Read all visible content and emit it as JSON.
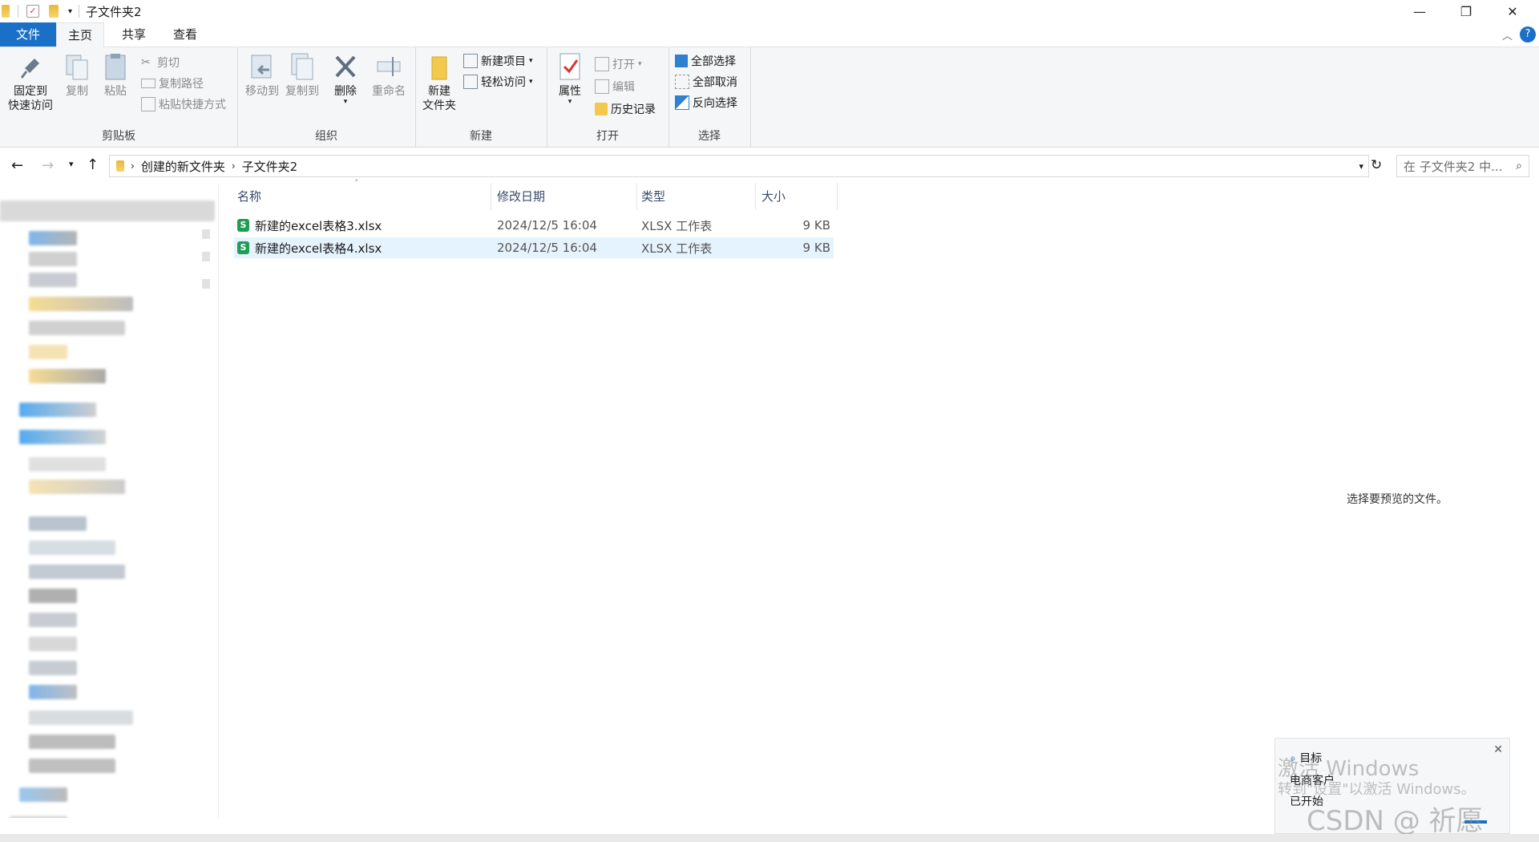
{
  "window": {
    "title": "子文件夹2",
    "controls": {
      "minimize": "—",
      "maximize": "❐",
      "close": "✕"
    }
  },
  "tabs": [
    {
      "label": "文件"
    },
    {
      "label": "主页"
    },
    {
      "label": "共享"
    },
    {
      "label": "查看"
    }
  ],
  "ribbon": {
    "clipboard": {
      "pin_label_1": "固定到",
      "pin_label_2": "快速访问",
      "copy": "复制",
      "paste": "粘贴",
      "cut": "剪切",
      "copy_path": "复制路径",
      "paste_shortcut": "粘贴快捷方式",
      "group": "剪贴板"
    },
    "organize": {
      "move_to": "移动到",
      "copy_to": "复制到",
      "delete": "删除",
      "rename": "重命名",
      "group": "组织"
    },
    "new": {
      "new_folder_1": "新建",
      "new_folder_2": "文件夹",
      "new_item": "新建项目",
      "easy_access": "轻松访问",
      "group": "新建"
    },
    "open": {
      "properties": "属性",
      "open": "打开",
      "edit": "编辑",
      "history": "历史记录",
      "group": "打开"
    },
    "select": {
      "select_all": "全部选择",
      "select_none": "全部取消",
      "invert": "反向选择",
      "group": "选择"
    }
  },
  "address": {
    "crumbs": [
      "创建的新文件夹",
      "子文件夹2"
    ],
    "search_placeholder": "在 子文件夹2 中..."
  },
  "columns": {
    "name": "名称",
    "date": "修改日期",
    "type": "类型",
    "size": "大小"
  },
  "files": [
    {
      "name": "新建的excel表格3.xlsx",
      "date": "2024/12/5 16:04",
      "type": "XLSX 工作表",
      "size": "9 KB"
    },
    {
      "name": "新建的excel表格4.xlsx",
      "date": "2024/12/5 16:04",
      "type": "XLSX 工作表",
      "size": "9 KB"
    }
  ],
  "preview_text": "选择要预览的文件。",
  "toast": {
    "line1": "目标",
    "line2": "电商客户",
    "line3": "已开始",
    "close": "✕"
  },
  "watermark": {
    "activate_title": "激活 Windows",
    "activate_sub": "转到\"设置\"以激活 Windows。",
    "csdn": "CSDN @ 祈愿"
  },
  "colors": {
    "accent": "#1a6fc6",
    "selection": "#e5f3ff",
    "ribbon_bg": "#f5f6f7"
  }
}
